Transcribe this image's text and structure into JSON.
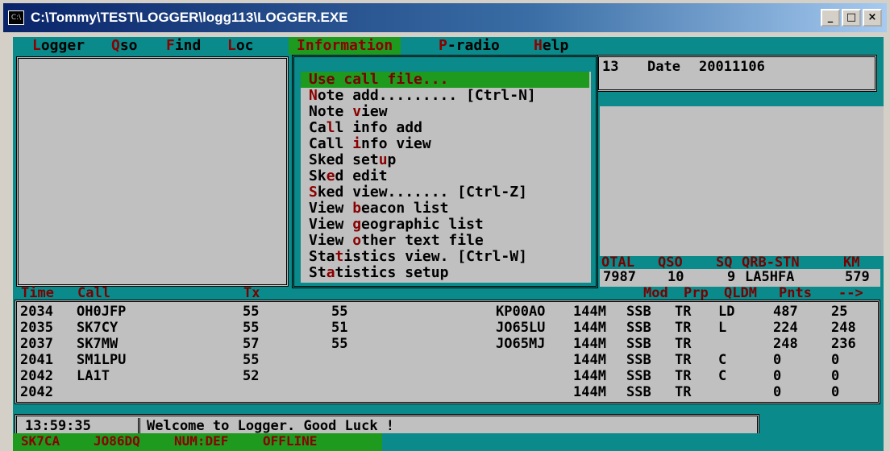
{
  "window": {
    "title": "C:\\Tommy\\TEST\\LOGGER\\logg113\\LOGGER.EXE",
    "icon_text": "C:\\",
    "minimize": "_",
    "maximize": "□",
    "close": "×"
  },
  "menu": {
    "items": [
      {
        "hot": "L",
        "rest": "ogger"
      },
      {
        "hot": "Q",
        "rest": "so"
      },
      {
        "hot": "F",
        "rest": "ind"
      },
      {
        "hot": "L",
        "rest": "oc"
      },
      {
        "hot": "I",
        "rest": "nformation"
      },
      {
        "hot": "P",
        "rest": "-radio"
      },
      {
        "hot": "H",
        "rest": "elp"
      }
    ]
  },
  "info_panel": {
    "fragment": "13",
    "date_label": "Date",
    "date_value": "20011106"
  },
  "dropdown": {
    "items": [
      {
        "pre": "Use ",
        "hot": "c",
        "post": "all file..."
      },
      {
        "pre": "",
        "hot": "N",
        "post": "ote add......... [Ctrl-N]"
      },
      {
        "pre": "Note ",
        "hot": "v",
        "post": "iew"
      },
      {
        "pre": "Ca",
        "hot": "l",
        "post": "l info add"
      },
      {
        "pre": "Call ",
        "hot": "i",
        "post": "nfo view"
      },
      {
        "pre": "Sked set",
        "hot": "u",
        "post": "p"
      },
      {
        "pre": "Sk",
        "hot": "e",
        "post": "d edit"
      },
      {
        "pre": "",
        "hot": "S",
        "post": "ked view....... [Ctrl-Z]"
      },
      {
        "pre": "View ",
        "hot": "b",
        "post": "eacon list"
      },
      {
        "pre": "View ",
        "hot": "g",
        "post": "eographic list"
      },
      {
        "pre": "View ",
        "hot": "o",
        "post": "ther text file"
      },
      {
        "pre": "Sta",
        "hot": "t",
        "post": "istics view. [Ctrl-W]"
      },
      {
        "pre": "St",
        "hot": "a",
        "post": "tistics setup"
      }
    ]
  },
  "totals": {
    "headers": [
      "OTAL",
      "QSO",
      "SQ",
      "QRB-STN",
      "KM"
    ],
    "values": [
      "7987",
      "10",
      "9",
      "LA5HFA",
      "579"
    ]
  },
  "log": {
    "headers": {
      "time": "Time",
      "call": "Call",
      "tx": "Tx",
      "mod": "Mod",
      "prp": "Prp",
      "qldm": "QLDM",
      "pnts": "Pnts",
      "arrow": "-->"
    },
    "rows": [
      {
        "time": "2034",
        "call": "OH0JFP",
        "tx": "55",
        "rx": "55",
        "loc": "KP00AO",
        "band": "144M",
        "mod": "SSB",
        "prp": "TR",
        "q": "LD",
        "pnts": "487",
        "last": "25"
      },
      {
        "time": "2035",
        "call": "SK7CY",
        "tx": "55",
        "rx": "51",
        "loc": "JO65LU",
        "band": "144M",
        "mod": "SSB",
        "prp": "TR",
        "q": "L",
        "pnts": "224",
        "last": "248"
      },
      {
        "time": "2037",
        "call": "SK7MW",
        "tx": "57",
        "rx": "55",
        "loc": "JO65MJ",
        "band": "144M",
        "mod": "SSB",
        "prp": "TR",
        "q": "",
        "pnts": "248",
        "last": "236"
      },
      {
        "time": "2041",
        "call": "SM1LPU",
        "tx": "55",
        "rx": "",
        "loc": "",
        "band": "144M",
        "mod": "SSB",
        "prp": "TR",
        "q": "C",
        "pnts": "0",
        "last": "0"
      },
      {
        "time": "2042",
        "call": "LA1T",
        "tx": "52",
        "rx": "",
        "loc": "",
        "band": "144M",
        "mod": "SSB",
        "prp": "TR",
        "q": "C",
        "pnts": "0",
        "last": "0"
      },
      {
        "time": "2042",
        "call": "",
        "tx": "",
        "rx": "",
        "loc": "",
        "band": "144M",
        "mod": "SSB",
        "prp": "TR",
        "q": "",
        "pnts": "0",
        "last": "0"
      }
    ]
  },
  "status": {
    "time": "13:59:35",
    "message": "Welcome to Logger. Good Luck !",
    "callsign": "SK7CA",
    "locator": "JO86DQ",
    "num": "NUM:DEF",
    "mode": "OFFLINE"
  }
}
